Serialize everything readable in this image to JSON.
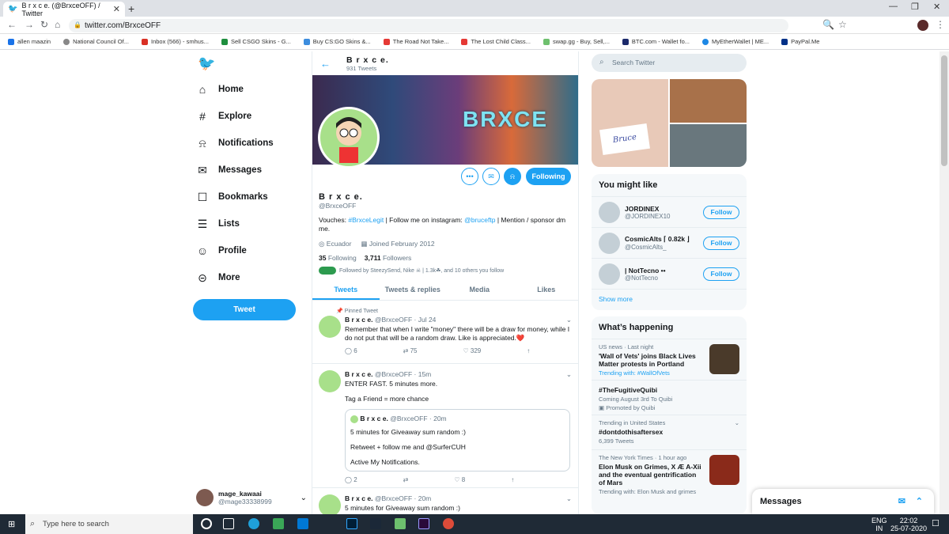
{
  "browser": {
    "tab_title": "B r x c e. (@BrxceOFF) / Twitter",
    "url": "twitter.com/BrxceOFF",
    "bookmarks": [
      "allen maazin",
      "National Council Of...",
      "Inbox (566) - smhus...",
      "Sell CSGO Skins - G...",
      "Buy CS:GO Skins &...",
      "The Road Not Take...",
      "The Lost Child Class...",
      "swap.gg - Buy, Sell,...",
      "BTC.com - Wallet fo...",
      "MyEtherWallet | ME...",
      "PayPal.Me"
    ]
  },
  "nav": {
    "items": [
      "Home",
      "Explore",
      "Notifications",
      "Messages",
      "Bookmarks",
      "Lists",
      "Profile",
      "More"
    ],
    "tweet_button": "Tweet",
    "account_name": "mage_kawaai",
    "account_handle": "@mage33338999"
  },
  "profile": {
    "header_name": "B r x c e.",
    "tweet_count": "931 Tweets",
    "banner_text": "BRXCE",
    "name": "B r x c e.",
    "handle": "@BrxceOFF",
    "bio_1": "Vouches: ",
    "bio_link1": "#BrxceLegit",
    "bio_2": " | Follow me on instagram: ",
    "bio_link2": "@bruceftp",
    "bio_3": " | Mention / sponsor dm me.",
    "location": "Ecuador",
    "joined": "Joined February 2012",
    "following_count": "35",
    "following_label": "Following",
    "followers_count": "3,711",
    "followers_label": "Followers",
    "followed_by": "Followed by SteezySend, Nike ☠ | 1.3k☘, and 10 others you follow",
    "follow_button": "Following"
  },
  "tabs": [
    "Tweets",
    "Tweets & replies",
    "Media",
    "Likes"
  ],
  "tweets": [
    {
      "pinned": "Pinned Tweet",
      "name": "B r x c e.",
      "meta": "@BrxceOFF · Jul 24",
      "text": "Remember that when I write \"money\" there will be a draw for money, while I do not put that will be a random draw. Like is appreciated.❤️",
      "replies": "6",
      "retweets": "75",
      "likes": "329"
    },
    {
      "name": "B r x c e.",
      "meta": "@BrxceOFF · 15m",
      "text1": "ENTER FAST. 5 minutes more.",
      "text2": "Tag a Friend = more chance",
      "quote_name": "B r x c e.",
      "quote_meta": "@BrxceOFF · 20m",
      "quote_1": "5 minutes for Giveaway sum random :)",
      "quote_2": "Retweet + follow me and @SurferCUH",
      "quote_3": "Active My Notifications.",
      "replies": "2",
      "retweets": "",
      "likes": "8"
    },
    {
      "name": "B r x c e.",
      "meta": "@BrxceOFF · 20m",
      "text": "5 minutes for Giveaway sum random :)"
    }
  ],
  "right": {
    "search_placeholder": "Search Twitter",
    "photo_caption": "Bruce",
    "might_like_title": "You might like",
    "suggestions": [
      {
        "name": "JORDINEX",
        "handle": "@JORDINEX10",
        "button": "Follow"
      },
      {
        "name": "CosmicAlts ⌈ 0.82k ⌋",
        "handle": "@CosmicAlts_",
        "button": "Follow"
      },
      {
        "name": "| NotTecno ••",
        "handle": "@NotTecno",
        "button": "Follow"
      }
    ],
    "show_more": "Show more",
    "happening_title": "What’s happening",
    "trends": [
      {
        "meta": "US news · Last night",
        "title": "'Wall of Vets' joins Black Lives Matter protests in Portland",
        "sub": "Trending with: #WallOfVets"
      },
      {
        "meta": "",
        "title": "#TheFugitiveQuibi",
        "sub": "Coming August 3rd To Quibi",
        "sub2": "Promoted by Quibi"
      },
      {
        "meta": "Trending in United States",
        "title": "#dontdothisaftersex",
        "sub": "6,399 Tweets"
      },
      {
        "meta": "The New York Times · 1 hour ago",
        "title": "Elon Musk on Grimes, X Æ A-Xii and the eventual gentrification of Mars",
        "sub": "Trending with: Elon Musk and grimes"
      }
    ],
    "messages_title": "Messages"
  },
  "taskbar": {
    "search_placeholder": "Type here to search",
    "lang": "ENG",
    "region": "IN",
    "time": "22:02",
    "date": "25-07-2020"
  },
  "colors": {
    "twitter_blue": "#1da1f2",
    "text": "#14171a",
    "muted": "#657786"
  }
}
